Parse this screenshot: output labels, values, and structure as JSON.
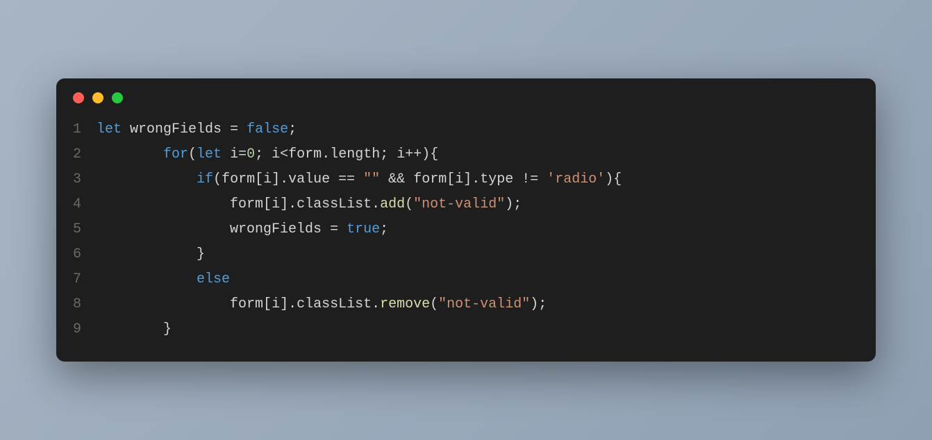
{
  "window": {
    "controls": {
      "close": "close",
      "minimize": "minimize",
      "maximize": "maximize"
    }
  },
  "code": {
    "language": "javascript",
    "lines": [
      {
        "num": "1",
        "tokens": [
          {
            "t": "let",
            "c": "kw"
          },
          {
            "t": " ",
            "c": "sp"
          },
          {
            "t": "wrongFields",
            "c": "var"
          },
          {
            "t": " = ",
            "c": "op"
          },
          {
            "t": "false",
            "c": "const"
          },
          {
            "t": ";",
            "c": "punc"
          }
        ]
      },
      {
        "num": "2",
        "tokens": [
          {
            "t": "        ",
            "c": "sp"
          },
          {
            "t": "for",
            "c": "kw"
          },
          {
            "t": "(",
            "c": "punc"
          },
          {
            "t": "let",
            "c": "kw"
          },
          {
            "t": " ",
            "c": "sp"
          },
          {
            "t": "i",
            "c": "var"
          },
          {
            "t": "=",
            "c": "op"
          },
          {
            "t": "0",
            "c": "num"
          },
          {
            "t": "; ",
            "c": "punc"
          },
          {
            "t": "i",
            "c": "var"
          },
          {
            "t": "<",
            "c": "op"
          },
          {
            "t": "form",
            "c": "var"
          },
          {
            "t": ".",
            "c": "punc"
          },
          {
            "t": "length",
            "c": "prop"
          },
          {
            "t": "; ",
            "c": "punc"
          },
          {
            "t": "i",
            "c": "var"
          },
          {
            "t": "++){",
            "c": "punc"
          }
        ]
      },
      {
        "num": "3",
        "tokens": [
          {
            "t": "            ",
            "c": "sp"
          },
          {
            "t": "if",
            "c": "kw"
          },
          {
            "t": "(",
            "c": "punc"
          },
          {
            "t": "form",
            "c": "var"
          },
          {
            "t": "[",
            "c": "punc"
          },
          {
            "t": "i",
            "c": "var"
          },
          {
            "t": "].",
            "c": "punc"
          },
          {
            "t": "value",
            "c": "prop"
          },
          {
            "t": " == ",
            "c": "op"
          },
          {
            "t": "\"\"",
            "c": "str"
          },
          {
            "t": " && ",
            "c": "op"
          },
          {
            "t": "form",
            "c": "var"
          },
          {
            "t": "[",
            "c": "punc"
          },
          {
            "t": "i",
            "c": "var"
          },
          {
            "t": "].",
            "c": "punc"
          },
          {
            "t": "type",
            "c": "prop"
          },
          {
            "t": " != ",
            "c": "op"
          },
          {
            "t": "'radio'",
            "c": "str"
          },
          {
            "t": "){",
            "c": "punc"
          }
        ]
      },
      {
        "num": "4",
        "tokens": [
          {
            "t": "                ",
            "c": "sp"
          },
          {
            "t": "form",
            "c": "var"
          },
          {
            "t": "[",
            "c": "punc"
          },
          {
            "t": "i",
            "c": "var"
          },
          {
            "t": "].",
            "c": "punc"
          },
          {
            "t": "classList",
            "c": "prop"
          },
          {
            "t": ".",
            "c": "punc"
          },
          {
            "t": "add",
            "c": "fn"
          },
          {
            "t": "(",
            "c": "punc"
          },
          {
            "t": "\"not-valid\"",
            "c": "str"
          },
          {
            "t": ");",
            "c": "punc"
          }
        ]
      },
      {
        "num": "5",
        "tokens": [
          {
            "t": "                ",
            "c": "sp"
          },
          {
            "t": "wrongFields",
            "c": "var"
          },
          {
            "t": " = ",
            "c": "op"
          },
          {
            "t": "true",
            "c": "const"
          },
          {
            "t": ";",
            "c": "punc"
          }
        ]
      },
      {
        "num": "6",
        "tokens": [
          {
            "t": "            }",
            "c": "punc"
          }
        ]
      },
      {
        "num": "7",
        "tokens": [
          {
            "t": "            ",
            "c": "sp"
          },
          {
            "t": "else",
            "c": "kw"
          }
        ]
      },
      {
        "num": "8",
        "tokens": [
          {
            "t": "                ",
            "c": "sp"
          },
          {
            "t": "form",
            "c": "var"
          },
          {
            "t": "[",
            "c": "punc"
          },
          {
            "t": "i",
            "c": "var"
          },
          {
            "t": "].",
            "c": "punc"
          },
          {
            "t": "classList",
            "c": "prop"
          },
          {
            "t": ".",
            "c": "punc"
          },
          {
            "t": "remove",
            "c": "fn"
          },
          {
            "t": "(",
            "c": "punc"
          },
          {
            "t": "\"not-valid\"",
            "c": "str"
          },
          {
            "t": ");",
            "c": "punc"
          }
        ]
      },
      {
        "num": "9",
        "tokens": [
          {
            "t": "        }",
            "c": "punc"
          }
        ]
      }
    ]
  }
}
